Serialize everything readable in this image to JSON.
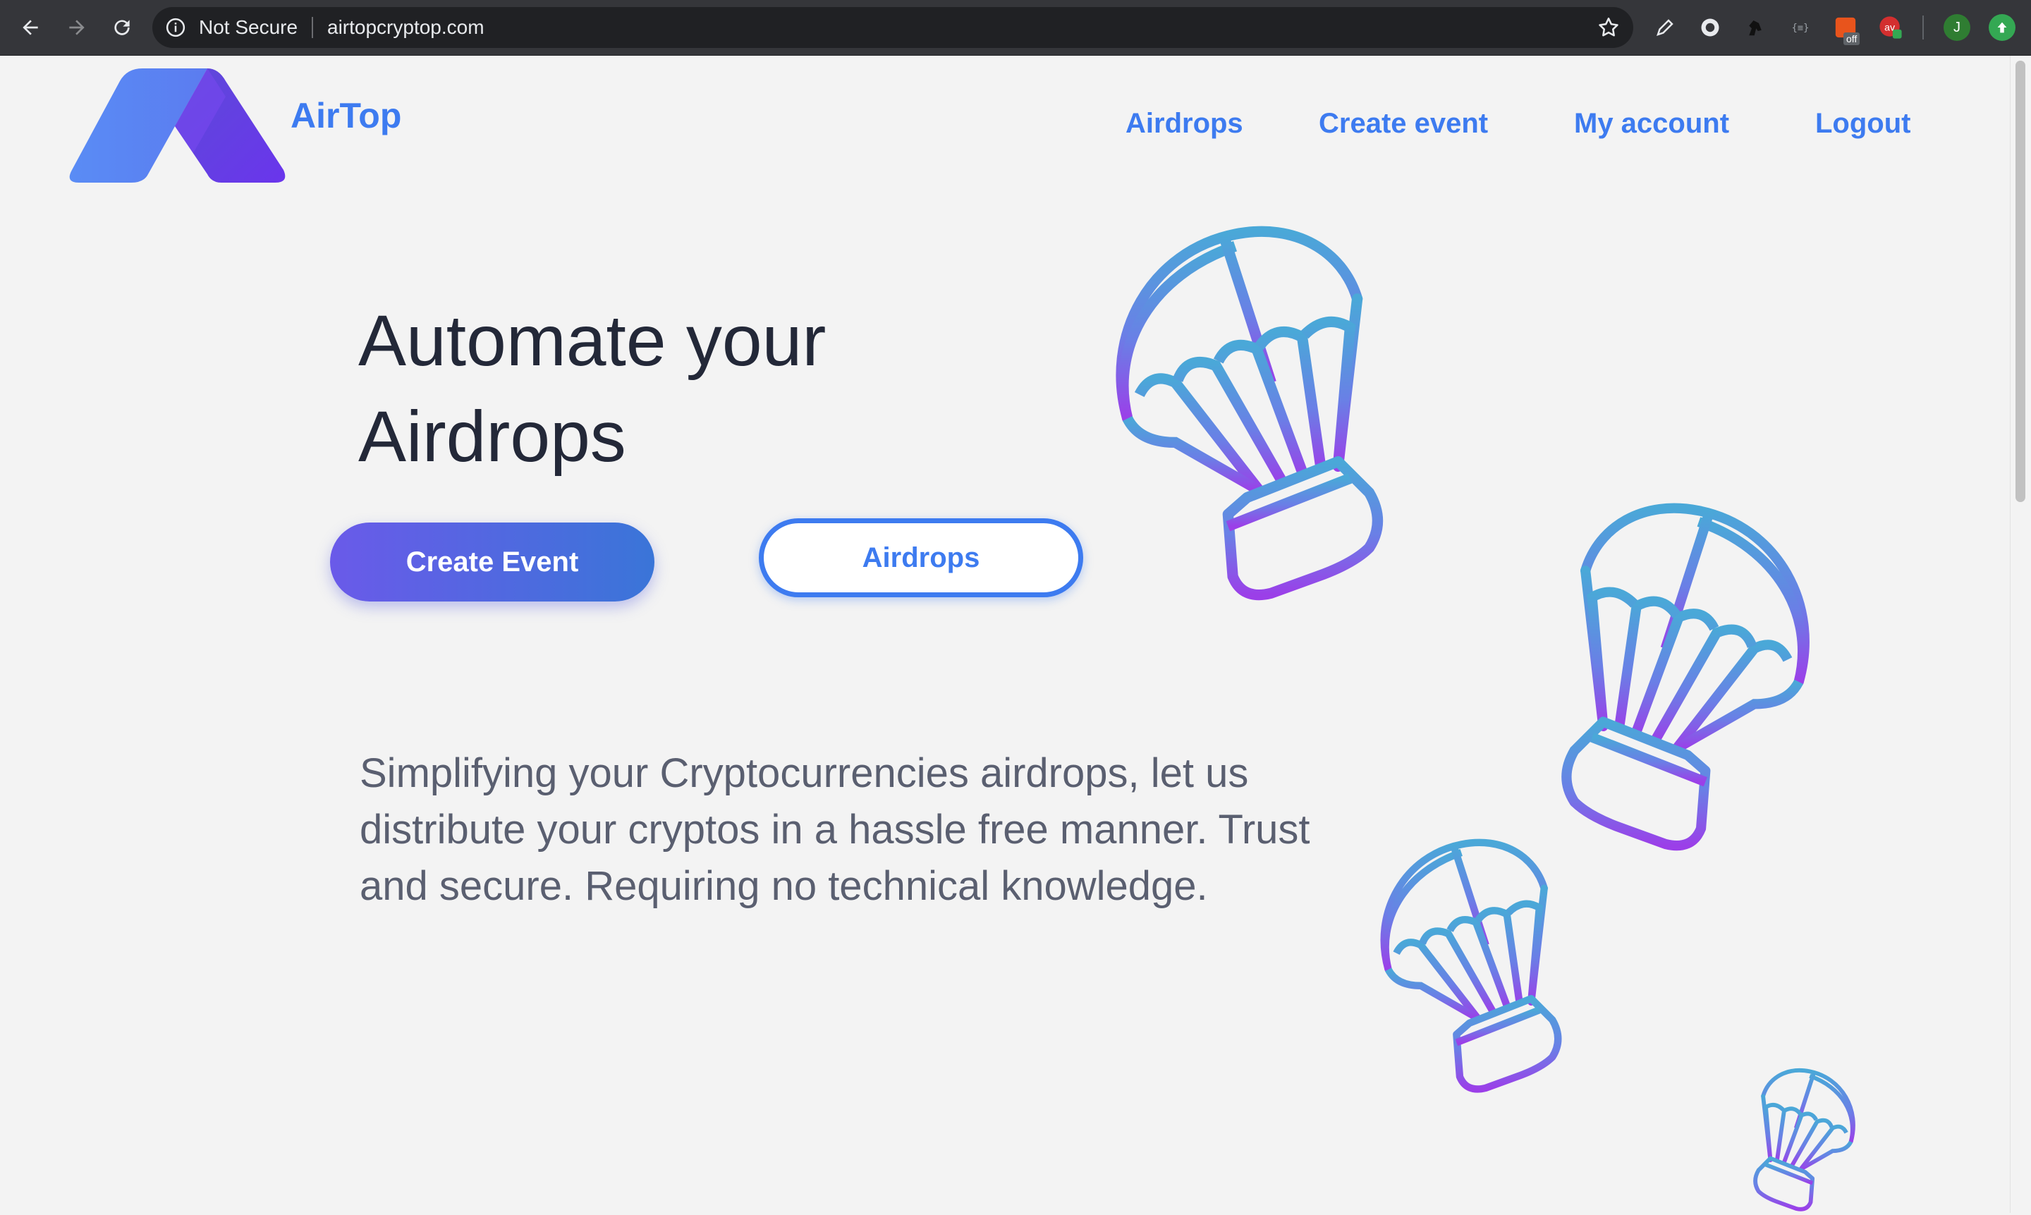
{
  "browser": {
    "security_label": "Not Secure",
    "url": "airtopcryptop.com",
    "extension_badge": "off",
    "profile_initial": "J",
    "icons": [
      "back-icon",
      "forward-icon",
      "reload-icon",
      "info-icon",
      "star-icon",
      "pen-icon",
      "extension-globe-icon",
      "extension-horse-icon",
      "extension-code-icon",
      "extension-off-icon",
      "extension-av-icon",
      "profile-avatar",
      "update-icon"
    ]
  },
  "site": {
    "brand": "AirTop",
    "nav": {
      "airdrops": "Airdrops",
      "create_event": "Create event",
      "my_account": "My account",
      "logout": "Logout"
    }
  },
  "hero": {
    "title_line1": "Automate your",
    "title_line2": "Airdrops",
    "primary_button": "Create Event",
    "secondary_button": "Airdrops",
    "description": "Simplifying your Cryptocurrencies airdrops, let us distribute your cryptos in a hassle free manner. Trust and secure. Requiring no technical knowledge."
  },
  "colors": {
    "accent": "#3d7bf0",
    "title": "#232838",
    "text": "#5a5f70",
    "background": "#f3f3f3",
    "balloon_gradient": [
      "#4aa8d8",
      "#9b3fe8"
    ]
  }
}
